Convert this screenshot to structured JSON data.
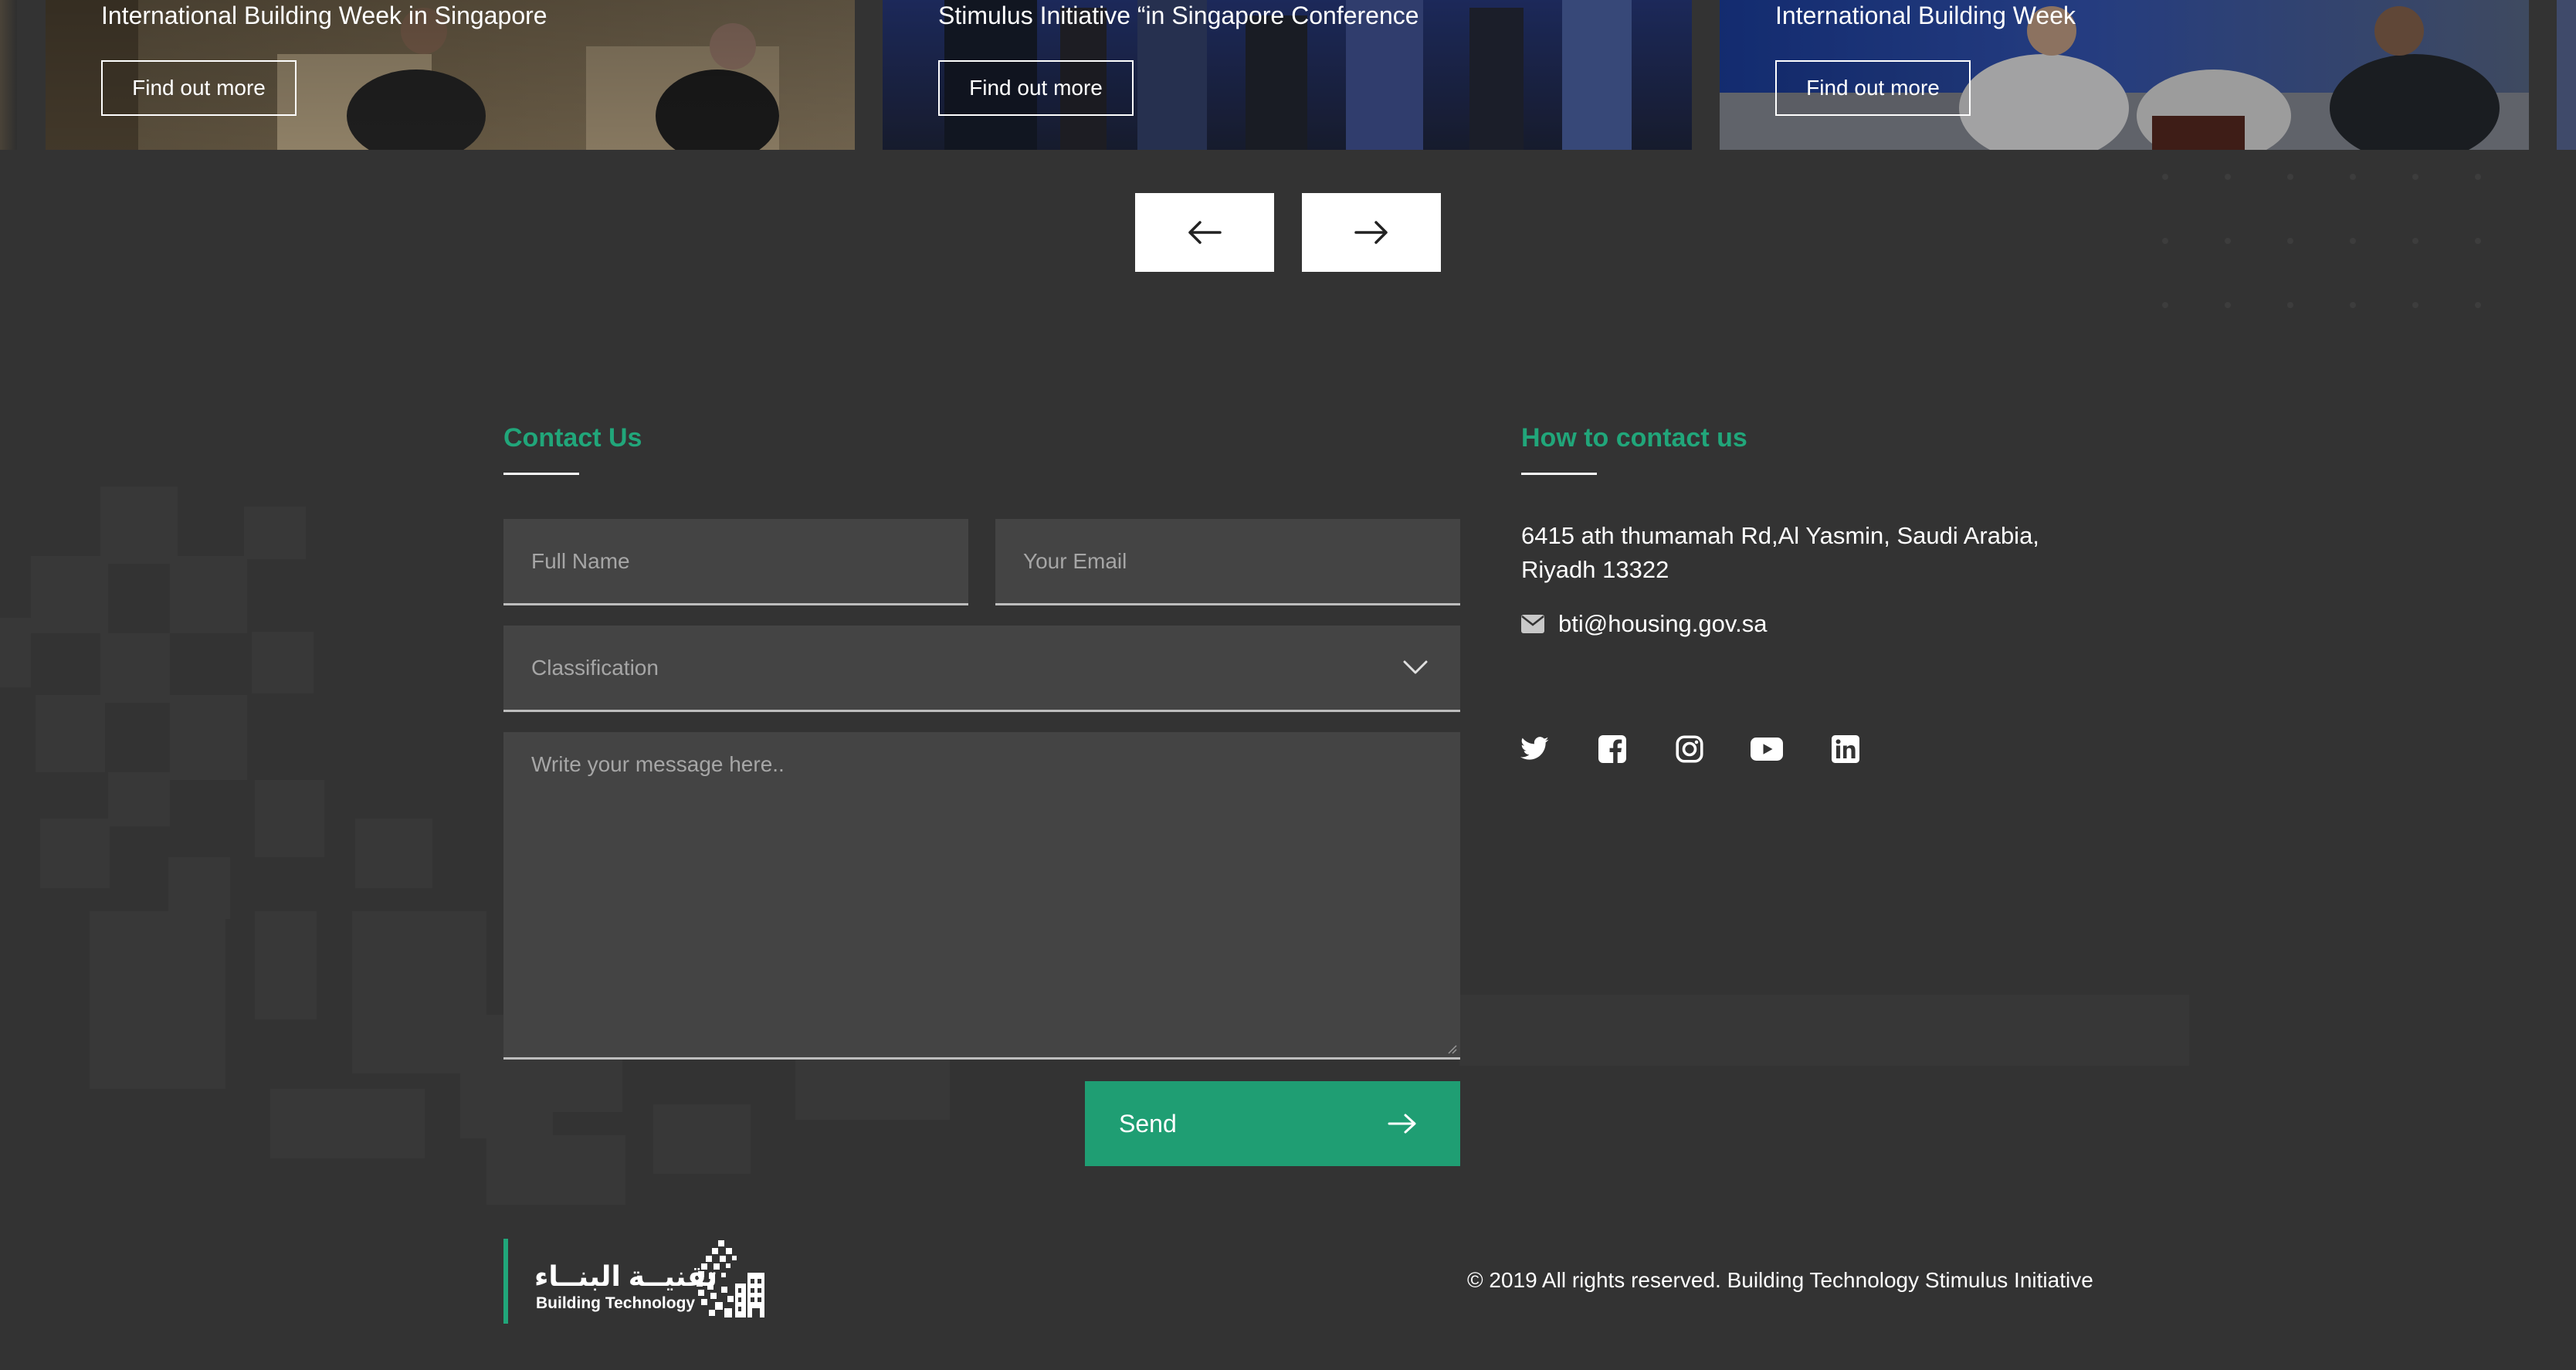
{
  "carousel": {
    "cards": [
      {
        "title": "International Building Week in Singapore",
        "button_label": "Find out more"
      },
      {
        "title": "Stimulus Initiative “in Singapore Conference",
        "button_label": "Find out more"
      },
      {
        "title": "International Building Week",
        "button_label": "Find out more"
      }
    ],
    "prev_icon": "arrow-left-icon",
    "next_icon": "arrow-right-icon"
  },
  "contact_form": {
    "title": "Contact Us",
    "full_name_placeholder": "Full Name",
    "email_placeholder": "Your Email",
    "classification_placeholder": "Classification",
    "message_placeholder": "Write your message here..",
    "send_label": "Send"
  },
  "contact_info": {
    "title": "How to contact us",
    "address_line1": "6415 ath thumamah Rd,Al Yasmin, Saudi Arabia,",
    "address_line2": "Riyadh 13322",
    "email": "bti@housing.gov.sa",
    "email_icon": "envelope-icon",
    "social": [
      "twitter-icon",
      "facebook-icon",
      "instagram-icon",
      "youtube-icon",
      "linkedin-icon"
    ]
  },
  "footer": {
    "logo_arabic": "تقنيــة البنــاء",
    "logo_english": "Building Technology",
    "copyright": "© 2019 All rights reserved. Building Technology Stimulus Initiative"
  },
  "colors": {
    "background": "#333333",
    "accent": "#21a67a",
    "send_button": "#1f9e73",
    "field": "#444444"
  }
}
